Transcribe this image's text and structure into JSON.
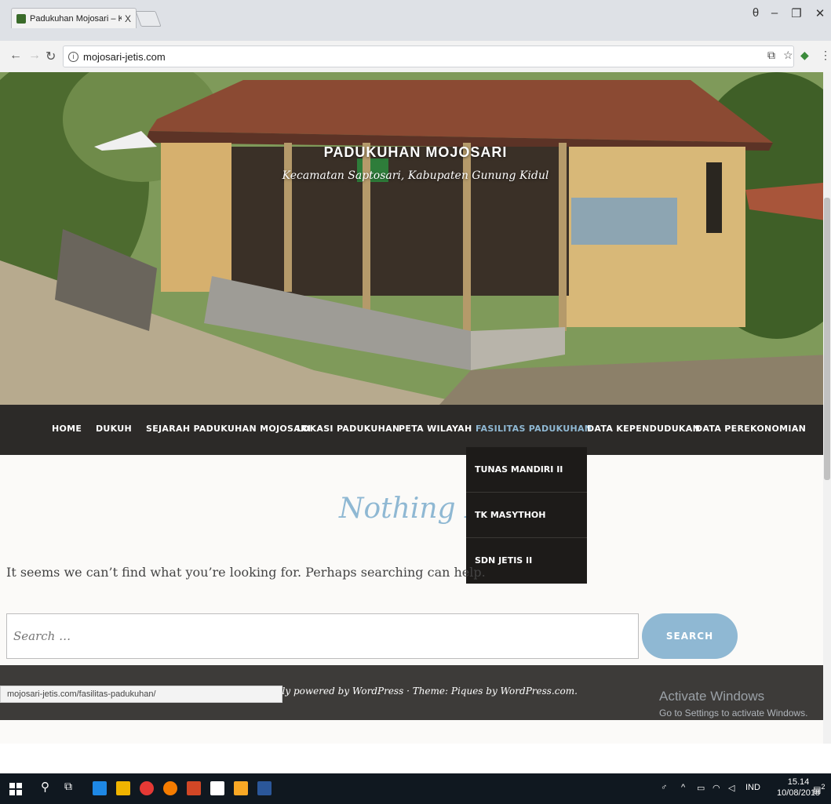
{
  "browser": {
    "tab_title": "Padukuhan Mojosari – Ke",
    "tab_close": "X",
    "url": "mojosari-jetis.com",
    "status_url": "mojosari-jetis.com/fasilitas-padukuhan/"
  },
  "site": {
    "title": "PADUKUHAN MOJOSARI",
    "description": "Kecamatan Saptosari, Kabupaten Gunung Kidul"
  },
  "nav": {
    "items": [
      {
        "label": "HOME"
      },
      {
        "label": "DUKUH"
      },
      {
        "label": "SEJARAH PADUKUHAN MOJOSARI"
      },
      {
        "label": "LOKASI PADUKUHAN"
      },
      {
        "label": "PETA WILAYAH"
      },
      {
        "label": "FASILITAS PADUKUHAN"
      },
      {
        "label": "DATA KEPENDUDUKAN"
      },
      {
        "label": "DATA PEREKONOMIAN"
      }
    ],
    "dropdown": [
      {
        "label": "TUNAS MANDIRI II"
      },
      {
        "label": "TK MASYTHOH"
      },
      {
        "label": "SDN JETIS II"
      }
    ]
  },
  "main": {
    "heading": "Nothing Fou",
    "message": "It seems we can’t find what you’re looking for. Perhaps searching can help.",
    "search_placeholder": "Search …",
    "search_button": "SEARCH"
  },
  "footer": {
    "credits": "Proudly powered by WordPress · Theme: Piques by WordPress.com."
  },
  "watermark": {
    "title": "Activate Windows",
    "subtitle": "Go to Settings to activate Windows."
  },
  "taskbar": {
    "lang": "IND",
    "time": "15.14",
    "date": "10/08/2018",
    "notif_count": "2"
  },
  "colors": {
    "accent": "#8fb8d3",
    "nav_bg": "#2c2a28",
    "dropdown_bg": "#1d1b19",
    "footer_bg": "#3d3b39"
  }
}
